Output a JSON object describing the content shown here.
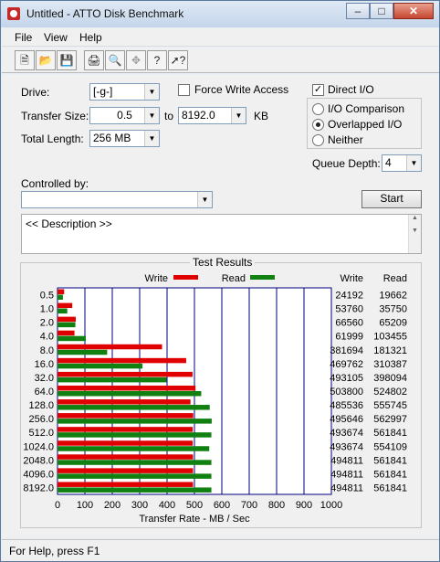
{
  "window": {
    "title": "Untitled - ATTO Disk Benchmark"
  },
  "menu": [
    "File",
    "View",
    "Help"
  ],
  "toolbar_icons": [
    "new-icon",
    "open-icon",
    "save-icon",
    "print-icon",
    "print-preview-icon",
    "move-icon",
    "about-icon",
    "context-help-icon"
  ],
  "form": {
    "drive_label": "Drive:",
    "drive_value": "[-g-]",
    "force_write_label": "Force Write Access",
    "force_write_checked": false,
    "direct_io_label": "Direct I/O",
    "direct_io_checked": true,
    "transfer_size_label": "Transfer Size:",
    "transfer_from": "0.5",
    "to_label": "to",
    "transfer_to": "8192.0",
    "kb_label": "KB",
    "total_length_label": "Total Length:",
    "total_length_value": "256 MB",
    "io_comparison_label": "I/O Comparison",
    "overlapped_io_label": "Overlapped I/O",
    "neither_label": "Neither",
    "selected_io_mode": "Overlapped I/O",
    "queue_depth_label": "Queue Depth:",
    "queue_depth_value": "4",
    "controlled_by_label": "Controlled by:",
    "controlled_by_value": "",
    "start_label": "Start",
    "description": "<< Description >>"
  },
  "chart_data": {
    "type": "bar",
    "title": "Test Results",
    "xlabel": "Transfer Rate - MB / Sec",
    "xlim": [
      0,
      1000
    ],
    "xticks": [
      0,
      100,
      200,
      300,
      400,
      500,
      600,
      700,
      800,
      900,
      1000
    ],
    "categories": [
      "0.5",
      "1.0",
      "2.0",
      "4.0",
      "8.0",
      "16.0",
      "32.0",
      "64.0",
      "128.0",
      "256.0",
      "512.0",
      "1024.0",
      "2048.0",
      "4096.0",
      "8192.0"
    ],
    "series": [
      {
        "name": "Write",
        "color": "#e00000",
        "values": [
          24192,
          53760,
          66560,
          61999,
          381694,
          469762,
          493105,
          503800,
          485536,
          495646,
          493674,
          493674,
          494811,
          494811,
          494811
        ]
      },
      {
        "name": "Read",
        "color": "#108010",
        "values": [
          19662,
          35750,
          65209,
          103455,
          181321,
          310387,
          398094,
          524802,
          555745,
          562997,
          561841,
          554109,
          561841,
          561841,
          561841
        ]
      }
    ],
    "column_headers": [
      "Write",
      "Read"
    ],
    "value_unit_divisor": 1000,
    "grid": true,
    "legend": "top"
  },
  "status": {
    "text": "For Help, press F1"
  }
}
